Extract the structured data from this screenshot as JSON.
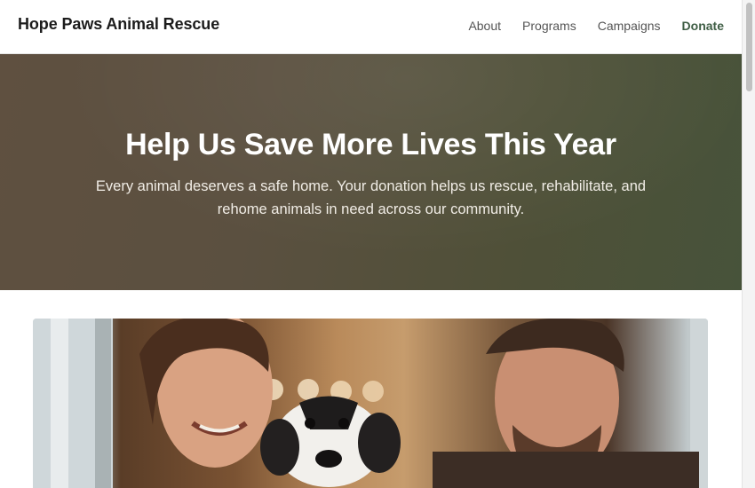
{
  "header": {
    "brand": "Hope Paws Animal Rescue",
    "nav": [
      {
        "label": "About"
      },
      {
        "label": "Programs"
      },
      {
        "label": "Campaigns"
      },
      {
        "label": "Donate"
      }
    ]
  },
  "hero": {
    "title": "Help Us Save More Lives This Year",
    "subtitle": "Every animal deserves a safe home. Your donation helps us rescue, rehabilitate, and rehome animals in need across our community."
  },
  "colors": {
    "accent": "#3f5e45",
    "hero_bg": "#574f3d"
  }
}
